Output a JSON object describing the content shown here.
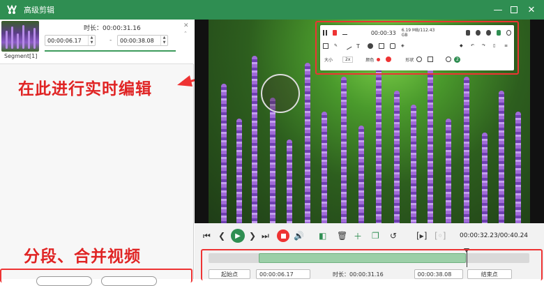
{
  "window": {
    "title": "高级剪辑",
    "accent": "#2f8e52",
    "min_icon": "minimize-icon",
    "max_icon": "maximize-icon",
    "close_icon": "close-icon"
  },
  "segment": {
    "label": "Segment[1]",
    "duration_label": "时长：",
    "duration": "00:00:31.16",
    "start": "00:00:06.17",
    "separator": "-",
    "end": "00:00:38.08"
  },
  "annotations": {
    "realtime_edit": "在此进行实时编辑",
    "split_merge": "分段、合并视频",
    "highlight_color": "#e33333"
  },
  "record_panel": {
    "timer": "00:00:33",
    "storage": "6.19 MB/112.43 GB",
    "size_label": "2x",
    "size_text": "大小",
    "color_label": "颜色",
    "shape_label": "形状",
    "count": "2"
  },
  "controls": {
    "current_time": "00:00:32.23",
    "total_time": "00:40.24",
    "time_separator": "/"
  },
  "timeline": {
    "start_btn": "起始点",
    "start_time": "00:00:06.17",
    "duration_label": "时长：",
    "duration": "00:00:31.16",
    "end_time": "00:00:38.08",
    "end_btn": "结束点",
    "selection_fraction": [
      0.158,
      0.81
    ],
    "playhead_fraction": 0.806
  }
}
